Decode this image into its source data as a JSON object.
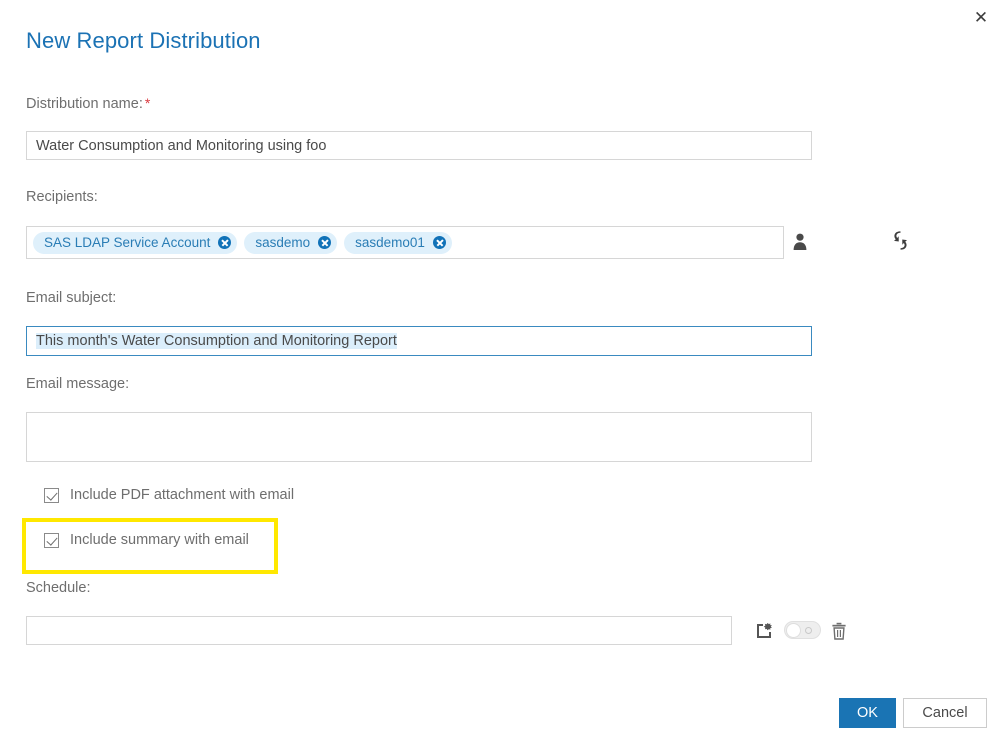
{
  "dialog": {
    "title": "New Report Distribution",
    "close_label": "✕"
  },
  "fields": {
    "distribution_name": {
      "label": "Distribution name:",
      "required_marker": "*",
      "value": "Water Consumption and Monitoring using foo",
      "placeholder": ""
    },
    "recipients": {
      "label": "Recipients:",
      "chips": [
        {
          "label": "SAS LDAP Service Account"
        },
        {
          "label": "sasdemo"
        },
        {
          "label": "sasdemo01"
        }
      ]
    },
    "email_subject": {
      "label": "Email subject:",
      "value": "This month's Water Consumption and Monitoring Report",
      "placeholder": ""
    },
    "email_message": {
      "label": "Email message:",
      "value": "",
      "placeholder": ""
    },
    "schedule": {
      "label": "Schedule:",
      "value": "",
      "placeholder": ""
    }
  },
  "checkboxes": [
    {
      "label": "Include PDF attachment with email",
      "checked": true
    },
    {
      "label": "Include summary with email",
      "checked": true
    }
  ],
  "icons": {
    "select_recipients": "person-icon",
    "refresh_recipients": "sync-icon",
    "new_schedule": "new-schedule-icon",
    "schedule_toggle": "toggle-switch-off",
    "delete_schedule": "trash-icon"
  },
  "footer": {
    "ok_label": "OK",
    "cancel_label": "Cancel"
  },
  "colors": {
    "title_blue": "#1b72b4",
    "primary_button": "#1a74b4",
    "chip_background": "#dff0fb",
    "chip_text": "#2a7db5",
    "required_red": "#d9393f",
    "highlight_yellow": "#ffe800",
    "focus_border": "#3a8ac0"
  }
}
